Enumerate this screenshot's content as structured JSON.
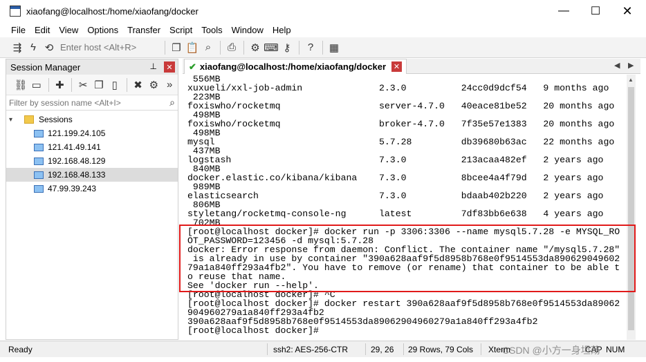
{
  "window": {
    "title": "xiaofang@localhost:/home/xiaofang/docker",
    "minimize": "—",
    "maximize": "☐",
    "close": "✕"
  },
  "menu": [
    "File",
    "Edit",
    "View",
    "Options",
    "Transfer",
    "Script",
    "Tools",
    "Window",
    "Help"
  ],
  "toolbar": {
    "host_placeholder": "Enter host <Alt+R>",
    "left_icons": [
      "connect-icon",
      "lightning-icon",
      "reconnect-icon"
    ],
    "right_icons": [
      "copy-icon",
      "paste-icon",
      "find-icon",
      "print-icon",
      "settings-icon",
      "keymap-icon",
      "keygen-icon",
      "help-icon",
      "sftp-icon"
    ]
  },
  "session_manager": {
    "title": "Session Manager",
    "pin": "📌",
    "close": "✕",
    "filter_placeholder": "Filter by session name <Alt+I>",
    "root": "Sessions",
    "sessions": [
      {
        "name": "121.199.24.105",
        "selected": false
      },
      {
        "name": "121.41.49.141",
        "selected": false
      },
      {
        "name": "192.168.48.129",
        "selected": false
      },
      {
        "name": "192.168.48.133",
        "selected": true
      },
      {
        "name": "47.99.39.243",
        "selected": false
      }
    ]
  },
  "tab": {
    "label": "xiaofang@localhost:/home/xiaofang/docker",
    "close": "✕"
  },
  "terminal": {
    "lines": [
      " 556MB",
      "xuxueli/xxl-job-admin              2.3.0          24cc0d9dcf54   9 months ago",
      " 223MB",
      "foxiswho/rocketmq                  server-4.7.0   40eace81be52   20 months ago",
      " 498MB",
      "foxiswho/rocketmq                  broker-4.7.0   7f35e57e1383   20 months ago",
      " 498MB",
      "mysql                              5.7.28         db39680b63ac   22 months ago",
      " 437MB",
      "logstash                           7.3.0          213acaa482ef   2 years ago",
      " 840MB",
      "docker.elastic.co/kibana/kibana    7.3.0          8bcee4a4f79d   2 years ago",
      " 989MB",
      "elasticsearch                      7.3.0          bdaab402b220   2 years ago",
      " 806MB",
      "styletang/rocketmq-console-ng      latest         7df83bb6e638   4 years ago",
      " 702MB",
      "[root@localhost docker]# docker run -p 3306:3306 --name mysql5.7.28 -e MYSQL_RO",
      "OT_PASSWORD=123456 -d mysql:5.7.28",
      "docker: Error response from daemon: Conflict. The container name \"/mysql5.7.28\"",
      " is already in use by container \"390a628aaf9f5d8958b768e0f9514553da890629049602",
      "79a1a840ff293a4fb2\". You have to remove (or rename) that container to be able t",
      "o reuse that name.",
      "See 'docker run --help'.",
      "[root@localhost docker]# ^C",
      "[root@localhost docker]# docker restart 390a628aaf9f5d8958b768e0f9514553da89062",
      "904960279a1a840ff293a4fb2",
      "390a628aaf9f5d8958b768e0f9514553da89062904960279a1a840ff293a4fb2",
      "[root@localhost docker]# "
    ]
  },
  "status": {
    "ready": "Ready",
    "cipher": "ssh2: AES-256-CTR",
    "cursor": "29,  26",
    "size": "29 Rows, 79 Cols",
    "term": "Xterm",
    "caps": "CAP",
    "num": "NUM"
  },
  "watermark": "CSDN @小方一身坦荡"
}
